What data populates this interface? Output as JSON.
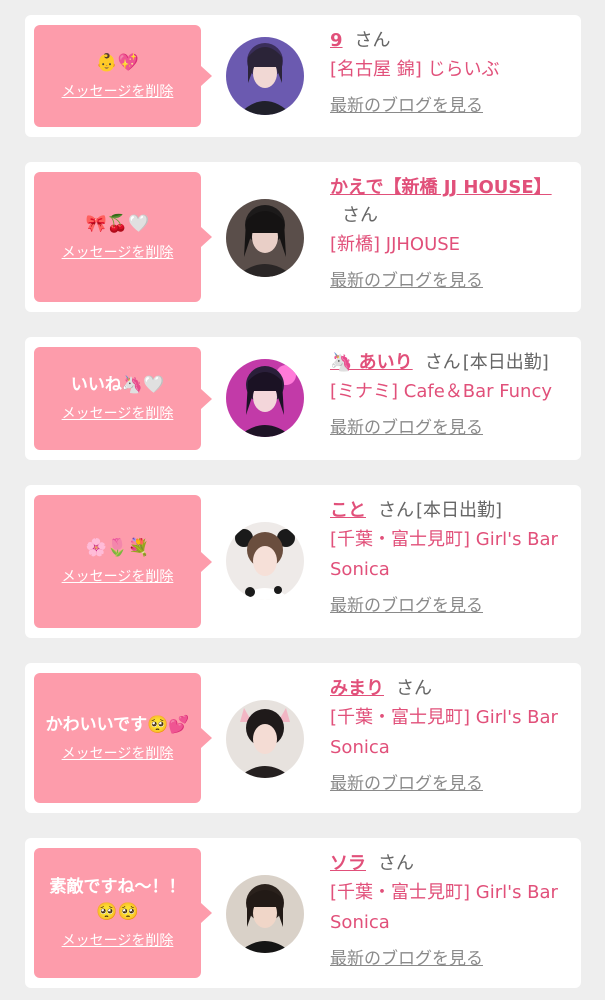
{
  "colors": {
    "accent": "#e1507a",
    "bubble": "#fd9cab",
    "background": "#eeeeee"
  },
  "entries": [
    {
      "message": "👶💖",
      "delete_label": "メッセージを削除",
      "name": "9",
      "honorific": "さん",
      "status": "",
      "shop": "[名古屋 錦] じらいぶ",
      "blog_link": "最新のブログを見る",
      "avatar": "avatar-photo-1"
    },
    {
      "message": "🎀🍒🤍",
      "delete_label": "メッセージを削除",
      "name": "かえで【新橋 JJ HOUSE】",
      "honorific": "さん",
      "status": "",
      "shop": "[新橋] JJHOUSE",
      "blog_link": "最新のブログを見る",
      "avatar": "avatar-photo-2"
    },
    {
      "message": "いいね🦄🤍",
      "delete_label": "メッセージを削除",
      "name": "🦄 あいり",
      "honorific": "さん",
      "status": "[本日出勤]",
      "shop": "[ミナミ] Cafe＆Bar Funcy",
      "blog_link": "最新のブログを見る",
      "avatar": "avatar-photo-3"
    },
    {
      "message": "🌸🌷💐",
      "delete_label": "メッセージを削除",
      "name": "こと",
      "honorific": "さん",
      "status": "[本日出勤]",
      "shop": "[千葉・富士見町] Girl's Bar Sonica",
      "blog_link": "最新のブログを見る",
      "avatar": "avatar-photo-4"
    },
    {
      "message": "かわいいです🥺💕",
      "delete_label": "メッセージを削除",
      "name": "みまり",
      "honorific": "さん",
      "status": "",
      "shop": "[千葉・富士見町] Girl's Bar Sonica",
      "blog_link": "最新のブログを見る",
      "avatar": "avatar-photo-5"
    },
    {
      "message": "素敵ですね〜！！🥺🥺",
      "delete_label": "メッセージを削除",
      "name": "ソラ",
      "honorific": "さん",
      "status": "",
      "shop": "[千葉・富士見町] Girl's Bar Sonica",
      "blog_link": "最新のブログを見る",
      "avatar": "avatar-photo-6"
    }
  ]
}
